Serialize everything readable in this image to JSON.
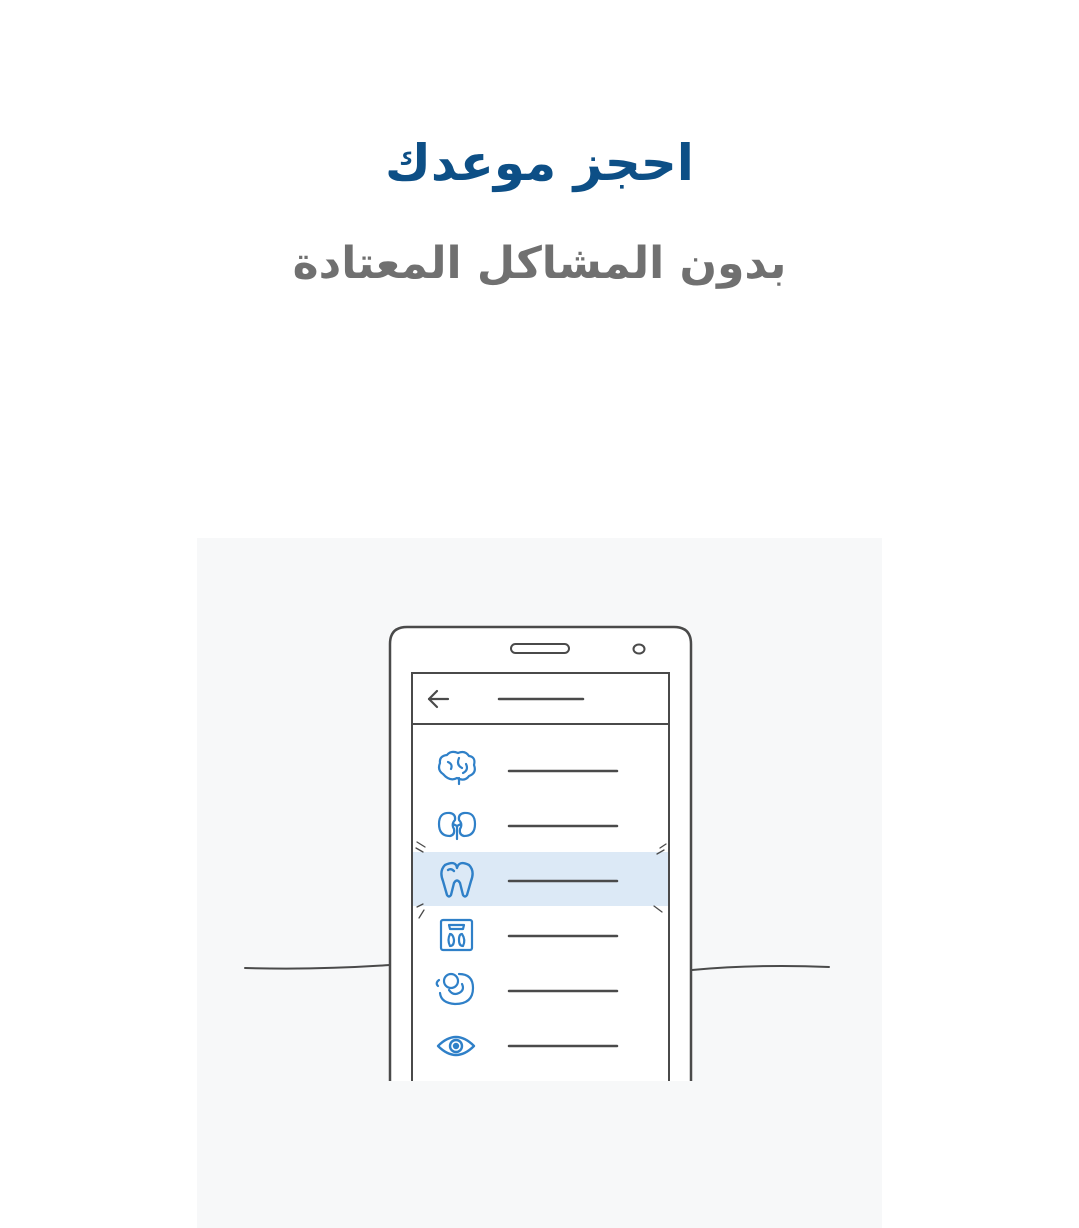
{
  "onboarding": {
    "title": "احجز موعدك",
    "subtitle": "بدون المشاكل المعتادة"
  },
  "colors": {
    "title": "#0d4f86",
    "subtitle": "#707070",
    "icon_blue": "#2f80c8",
    "line": "#4a4a4a",
    "highlight": "#dce9f6",
    "illustration_bg": "#f7f8f9"
  },
  "illustration": {
    "selected_index": 2,
    "list_icons": [
      "brain-icon",
      "kidneys-icon",
      "tooth-icon",
      "weight-scale-icon",
      "fetus-icon",
      "eye-icon"
    ]
  }
}
